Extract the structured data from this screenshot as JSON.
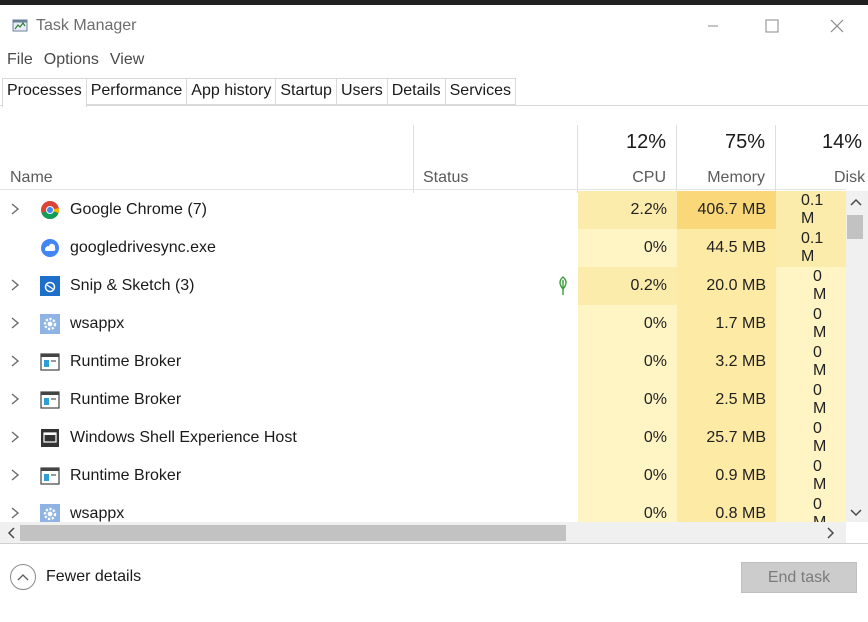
{
  "window": {
    "title": "Task Manager"
  },
  "menu": [
    "File",
    "Options",
    "View"
  ],
  "tabs": [
    "Processes",
    "Performance",
    "App history",
    "Startup",
    "Users",
    "Details",
    "Services"
  ],
  "columns": {
    "name": "Name",
    "status": "Status",
    "cpu": {
      "percent": "12%",
      "label": "CPU"
    },
    "memory": {
      "percent": "75%",
      "label": "Memory"
    },
    "disk": {
      "percent": "14%",
      "label": "Disk"
    }
  },
  "processes": [
    {
      "name": "Google Chrome (7)",
      "icon": "chrome-icon",
      "expandable": true,
      "status": "",
      "cpu": "2.2%",
      "memory": "406.7 MB",
      "disk": "0.1 M"
    },
    {
      "name": "googledrivesync.exe",
      "icon": "google-drive-sync-icon",
      "expandable": false,
      "status": "",
      "cpu": "0%",
      "memory": "44.5 MB",
      "disk": "0.1 M"
    },
    {
      "name": "Snip & Sketch (3)",
      "icon": "snip-sketch-icon",
      "expandable": true,
      "status": "suspended-leaf-icon",
      "cpu": "0.2%",
      "memory": "20.0 MB",
      "disk": "0 M"
    },
    {
      "name": "wsappx",
      "icon": "gear-icon",
      "expandable": true,
      "status": "",
      "cpu": "0%",
      "memory": "1.7 MB",
      "disk": "0 M"
    },
    {
      "name": "Runtime Broker",
      "icon": "runtime-broker-icon",
      "expandable": true,
      "status": "",
      "cpu": "0%",
      "memory": "3.2 MB",
      "disk": "0 M"
    },
    {
      "name": "Runtime Broker",
      "icon": "runtime-broker-icon",
      "expandable": true,
      "status": "",
      "cpu": "0%",
      "memory": "2.5 MB",
      "disk": "0 M"
    },
    {
      "name": "Windows Shell Experience Host",
      "icon": "shell-host-icon",
      "expandable": true,
      "status": "",
      "cpu": "0%",
      "memory": "25.7 MB",
      "disk": "0 M"
    },
    {
      "name": "Runtime Broker",
      "icon": "runtime-broker-icon",
      "expandable": true,
      "status": "",
      "cpu": "0%",
      "memory": "0.9 MB",
      "disk": "0 M"
    },
    {
      "name": "wsappx",
      "icon": "gear-icon",
      "expandable": true,
      "status": "",
      "cpu": "0%",
      "memory": "0.8 MB",
      "disk": "0 M"
    }
  ],
  "footer": {
    "fewer_details": "Fewer details",
    "end_task": "End task"
  }
}
